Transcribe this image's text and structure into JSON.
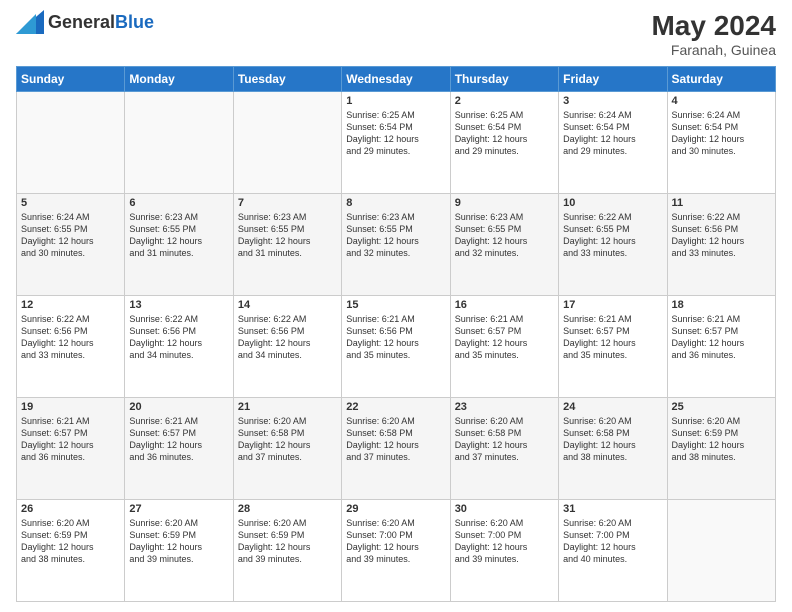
{
  "header": {
    "logo_general": "General",
    "logo_blue": "Blue",
    "month_year": "May 2024",
    "location": "Faranah, Guinea"
  },
  "days_of_week": [
    "Sunday",
    "Monday",
    "Tuesday",
    "Wednesday",
    "Thursday",
    "Friday",
    "Saturday"
  ],
  "weeks": [
    [
      {
        "day": "",
        "info": ""
      },
      {
        "day": "",
        "info": ""
      },
      {
        "day": "",
        "info": ""
      },
      {
        "day": "1",
        "info": "Sunrise: 6:25 AM\nSunset: 6:54 PM\nDaylight: 12 hours\nand 29 minutes."
      },
      {
        "day": "2",
        "info": "Sunrise: 6:25 AM\nSunset: 6:54 PM\nDaylight: 12 hours\nand 29 minutes."
      },
      {
        "day": "3",
        "info": "Sunrise: 6:24 AM\nSunset: 6:54 PM\nDaylight: 12 hours\nand 29 minutes."
      },
      {
        "day": "4",
        "info": "Sunrise: 6:24 AM\nSunset: 6:54 PM\nDaylight: 12 hours\nand 30 minutes."
      }
    ],
    [
      {
        "day": "5",
        "info": "Sunrise: 6:24 AM\nSunset: 6:55 PM\nDaylight: 12 hours\nand 30 minutes."
      },
      {
        "day": "6",
        "info": "Sunrise: 6:23 AM\nSunset: 6:55 PM\nDaylight: 12 hours\nand 31 minutes."
      },
      {
        "day": "7",
        "info": "Sunrise: 6:23 AM\nSunset: 6:55 PM\nDaylight: 12 hours\nand 31 minutes."
      },
      {
        "day": "8",
        "info": "Sunrise: 6:23 AM\nSunset: 6:55 PM\nDaylight: 12 hours\nand 32 minutes."
      },
      {
        "day": "9",
        "info": "Sunrise: 6:23 AM\nSunset: 6:55 PM\nDaylight: 12 hours\nand 32 minutes."
      },
      {
        "day": "10",
        "info": "Sunrise: 6:22 AM\nSunset: 6:55 PM\nDaylight: 12 hours\nand 33 minutes."
      },
      {
        "day": "11",
        "info": "Sunrise: 6:22 AM\nSunset: 6:56 PM\nDaylight: 12 hours\nand 33 minutes."
      }
    ],
    [
      {
        "day": "12",
        "info": "Sunrise: 6:22 AM\nSunset: 6:56 PM\nDaylight: 12 hours\nand 33 minutes."
      },
      {
        "day": "13",
        "info": "Sunrise: 6:22 AM\nSunset: 6:56 PM\nDaylight: 12 hours\nand 34 minutes."
      },
      {
        "day": "14",
        "info": "Sunrise: 6:22 AM\nSunset: 6:56 PM\nDaylight: 12 hours\nand 34 minutes."
      },
      {
        "day": "15",
        "info": "Sunrise: 6:21 AM\nSunset: 6:56 PM\nDaylight: 12 hours\nand 35 minutes."
      },
      {
        "day": "16",
        "info": "Sunrise: 6:21 AM\nSunset: 6:57 PM\nDaylight: 12 hours\nand 35 minutes."
      },
      {
        "day": "17",
        "info": "Sunrise: 6:21 AM\nSunset: 6:57 PM\nDaylight: 12 hours\nand 35 minutes."
      },
      {
        "day": "18",
        "info": "Sunrise: 6:21 AM\nSunset: 6:57 PM\nDaylight: 12 hours\nand 36 minutes."
      }
    ],
    [
      {
        "day": "19",
        "info": "Sunrise: 6:21 AM\nSunset: 6:57 PM\nDaylight: 12 hours\nand 36 minutes."
      },
      {
        "day": "20",
        "info": "Sunrise: 6:21 AM\nSunset: 6:57 PM\nDaylight: 12 hours\nand 36 minutes."
      },
      {
        "day": "21",
        "info": "Sunrise: 6:20 AM\nSunset: 6:58 PM\nDaylight: 12 hours\nand 37 minutes."
      },
      {
        "day": "22",
        "info": "Sunrise: 6:20 AM\nSunset: 6:58 PM\nDaylight: 12 hours\nand 37 minutes."
      },
      {
        "day": "23",
        "info": "Sunrise: 6:20 AM\nSunset: 6:58 PM\nDaylight: 12 hours\nand 37 minutes."
      },
      {
        "day": "24",
        "info": "Sunrise: 6:20 AM\nSunset: 6:58 PM\nDaylight: 12 hours\nand 38 minutes."
      },
      {
        "day": "25",
        "info": "Sunrise: 6:20 AM\nSunset: 6:59 PM\nDaylight: 12 hours\nand 38 minutes."
      }
    ],
    [
      {
        "day": "26",
        "info": "Sunrise: 6:20 AM\nSunset: 6:59 PM\nDaylight: 12 hours\nand 38 minutes."
      },
      {
        "day": "27",
        "info": "Sunrise: 6:20 AM\nSunset: 6:59 PM\nDaylight: 12 hours\nand 39 minutes."
      },
      {
        "day": "28",
        "info": "Sunrise: 6:20 AM\nSunset: 6:59 PM\nDaylight: 12 hours\nand 39 minutes."
      },
      {
        "day": "29",
        "info": "Sunrise: 6:20 AM\nSunset: 7:00 PM\nDaylight: 12 hours\nand 39 minutes."
      },
      {
        "day": "30",
        "info": "Sunrise: 6:20 AM\nSunset: 7:00 PM\nDaylight: 12 hours\nand 39 minutes."
      },
      {
        "day": "31",
        "info": "Sunrise: 6:20 AM\nSunset: 7:00 PM\nDaylight: 12 hours\nand 40 minutes."
      },
      {
        "day": "",
        "info": ""
      }
    ]
  ]
}
